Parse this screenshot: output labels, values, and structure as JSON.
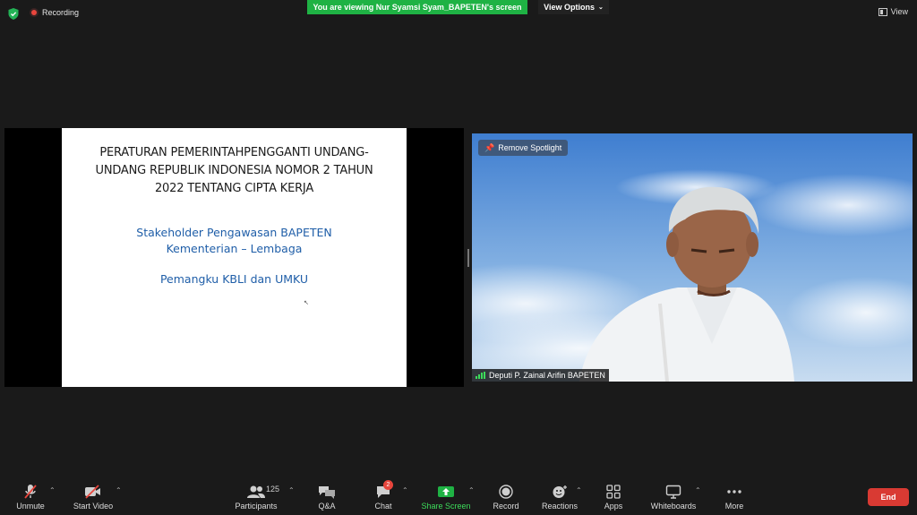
{
  "top_bar": {
    "recording_label": "Recording",
    "banner": "You are viewing Nur Syamsi Syam_BAPETEN's screen",
    "view_options": "View Options",
    "view_label": "View"
  },
  "slide": {
    "title_lines": [
      "PERATURAN PEMERINTAHPENGGANTI UNDANG-",
      "UNDANG REPUBLIK INDONESIA NOMOR 2 TAHUN",
      "2022 TENTANG CIPTA KERJA"
    ],
    "line1": "Stakeholder Pengawasan BAPETEN",
    "line2": "Kementerian – Lembaga",
    "line3": "Pemangku KBLI dan UMKU"
  },
  "video": {
    "spotlight_label": "Remove Spotlight",
    "participant_name": "Deputi P. Zainal Arifin BAPETEN"
  },
  "toolbar": {
    "unmute": "Unmute",
    "start_video": "Start Video",
    "participants": "Participants",
    "participants_count": "125",
    "qa": "Q&A",
    "chat": "Chat",
    "chat_badge": "2",
    "share_screen": "Share Screen",
    "record": "Record",
    "reactions": "Reactions",
    "apps": "Apps",
    "whiteboards": "Whiteboards",
    "more": "More",
    "end": "End"
  },
  "colors": {
    "banner_green": "#1fb244",
    "share_green": "#3ddc5b",
    "end_red": "#d93a33",
    "slide_blue": "#1f5ea8"
  }
}
